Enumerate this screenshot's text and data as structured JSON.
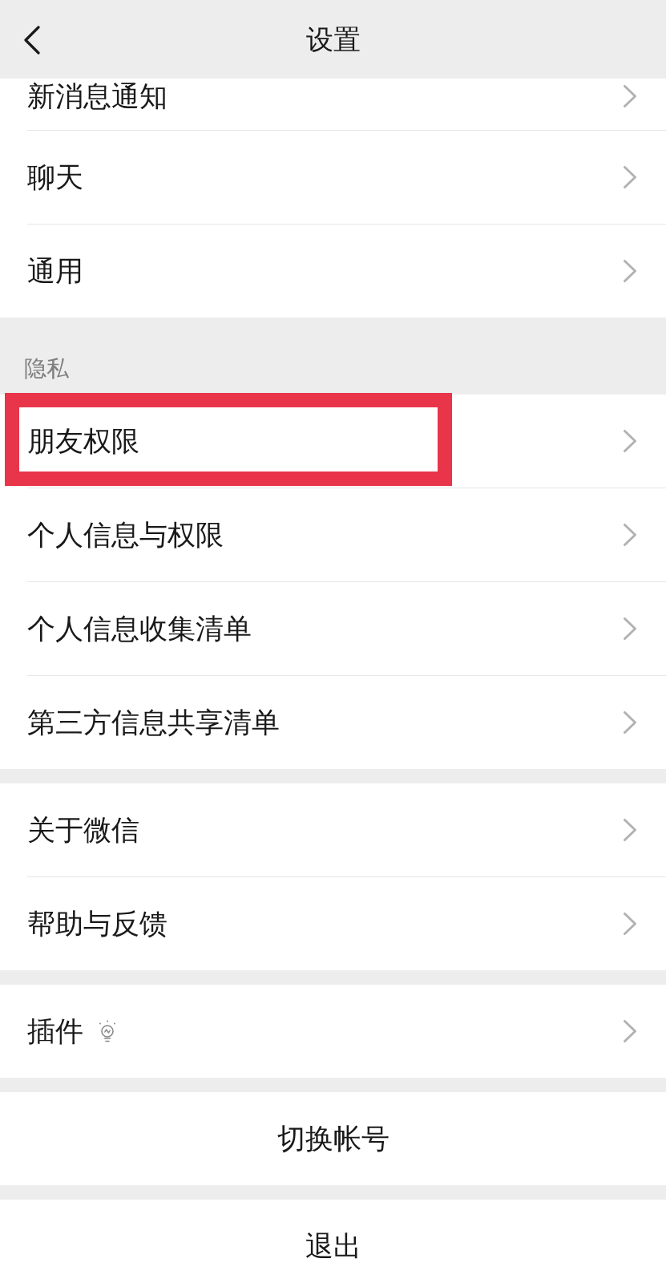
{
  "header": {
    "title": "设置"
  },
  "sections": [
    {
      "items": [
        {
          "label": "新消息通知",
          "kind": "plain",
          "highlighted": false
        },
        {
          "label": "聊天",
          "kind": "plain",
          "highlighted": false
        },
        {
          "label": "通用",
          "kind": "plain",
          "highlighted": false
        }
      ]
    },
    {
      "title": "隐私",
      "items": [
        {
          "label": "朋友权限",
          "kind": "plain",
          "highlighted": true
        },
        {
          "label": "个人信息与权限",
          "kind": "plain",
          "highlighted": false
        },
        {
          "label": "个人信息收集清单",
          "kind": "plain",
          "highlighted": false
        },
        {
          "label": "第三方信息共享清单",
          "kind": "plain",
          "highlighted": false
        }
      ]
    },
    {
      "items": [
        {
          "label": "关于微信",
          "kind": "plain",
          "highlighted": false
        },
        {
          "label": "帮助与反馈",
          "kind": "plain",
          "highlighted": false
        }
      ]
    },
    {
      "items": [
        {
          "label": "插件",
          "kind": "tip",
          "highlighted": false
        }
      ]
    }
  ],
  "actions": [
    {
      "label": "切换帐号"
    },
    {
      "label": "退出"
    }
  ]
}
